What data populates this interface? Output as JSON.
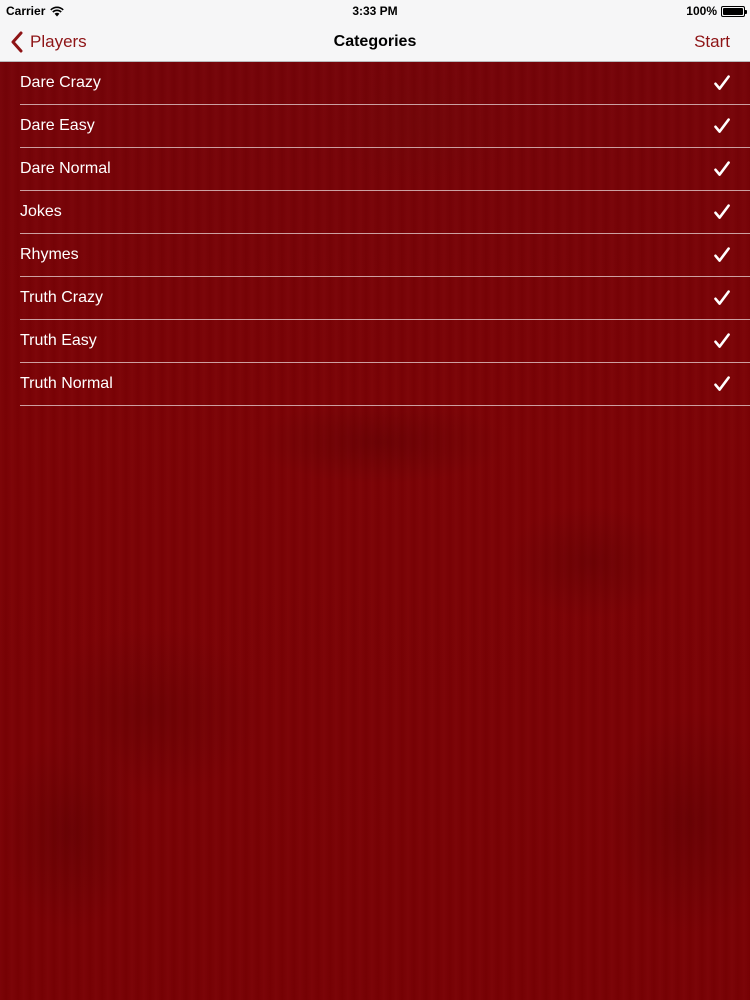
{
  "status_bar": {
    "carrier": "Carrier",
    "time": "3:33 PM",
    "battery": "100%",
    "icons": [
      "wifi-icon",
      "battery-icon"
    ]
  },
  "nav_bar": {
    "back_label": "Players",
    "title": "Categories",
    "start_label": "Start"
  },
  "categories": [
    {
      "label": "Dare Crazy",
      "checked": true
    },
    {
      "label": "Dare Easy",
      "checked": true
    },
    {
      "label": "Dare Normal",
      "checked": true
    },
    {
      "label": "Jokes",
      "checked": true
    },
    {
      "label": "Rhymes",
      "checked": true
    },
    {
      "label": "Truth Crazy",
      "checked": true
    },
    {
      "label": "Truth Easy",
      "checked": true
    },
    {
      "label": "Truth Normal",
      "checked": true
    }
  ],
  "colors": {
    "accent": "#8e1416",
    "background": "#7a0205",
    "bar": "#f6f6f7",
    "row_text": "#ffffff"
  }
}
